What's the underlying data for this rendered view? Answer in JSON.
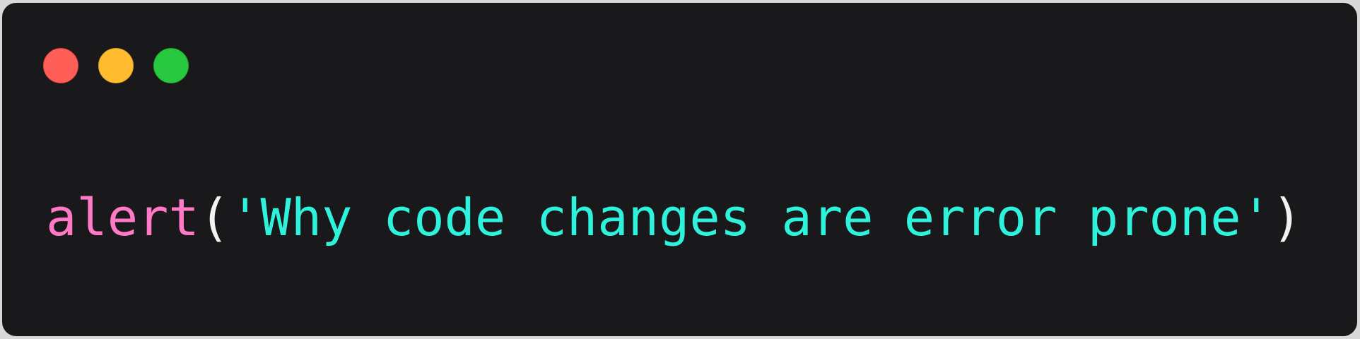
{
  "window": {
    "controls": {
      "close": {
        "color": "#ff5f57"
      },
      "minimize": {
        "color": "#febc2e"
      },
      "zoom": {
        "color": "#28c840"
      }
    }
  },
  "code": {
    "function_name": "alert",
    "open_paren": "(",
    "string_literal": "'Why code changes are error prone'",
    "close_paren": ")"
  }
}
